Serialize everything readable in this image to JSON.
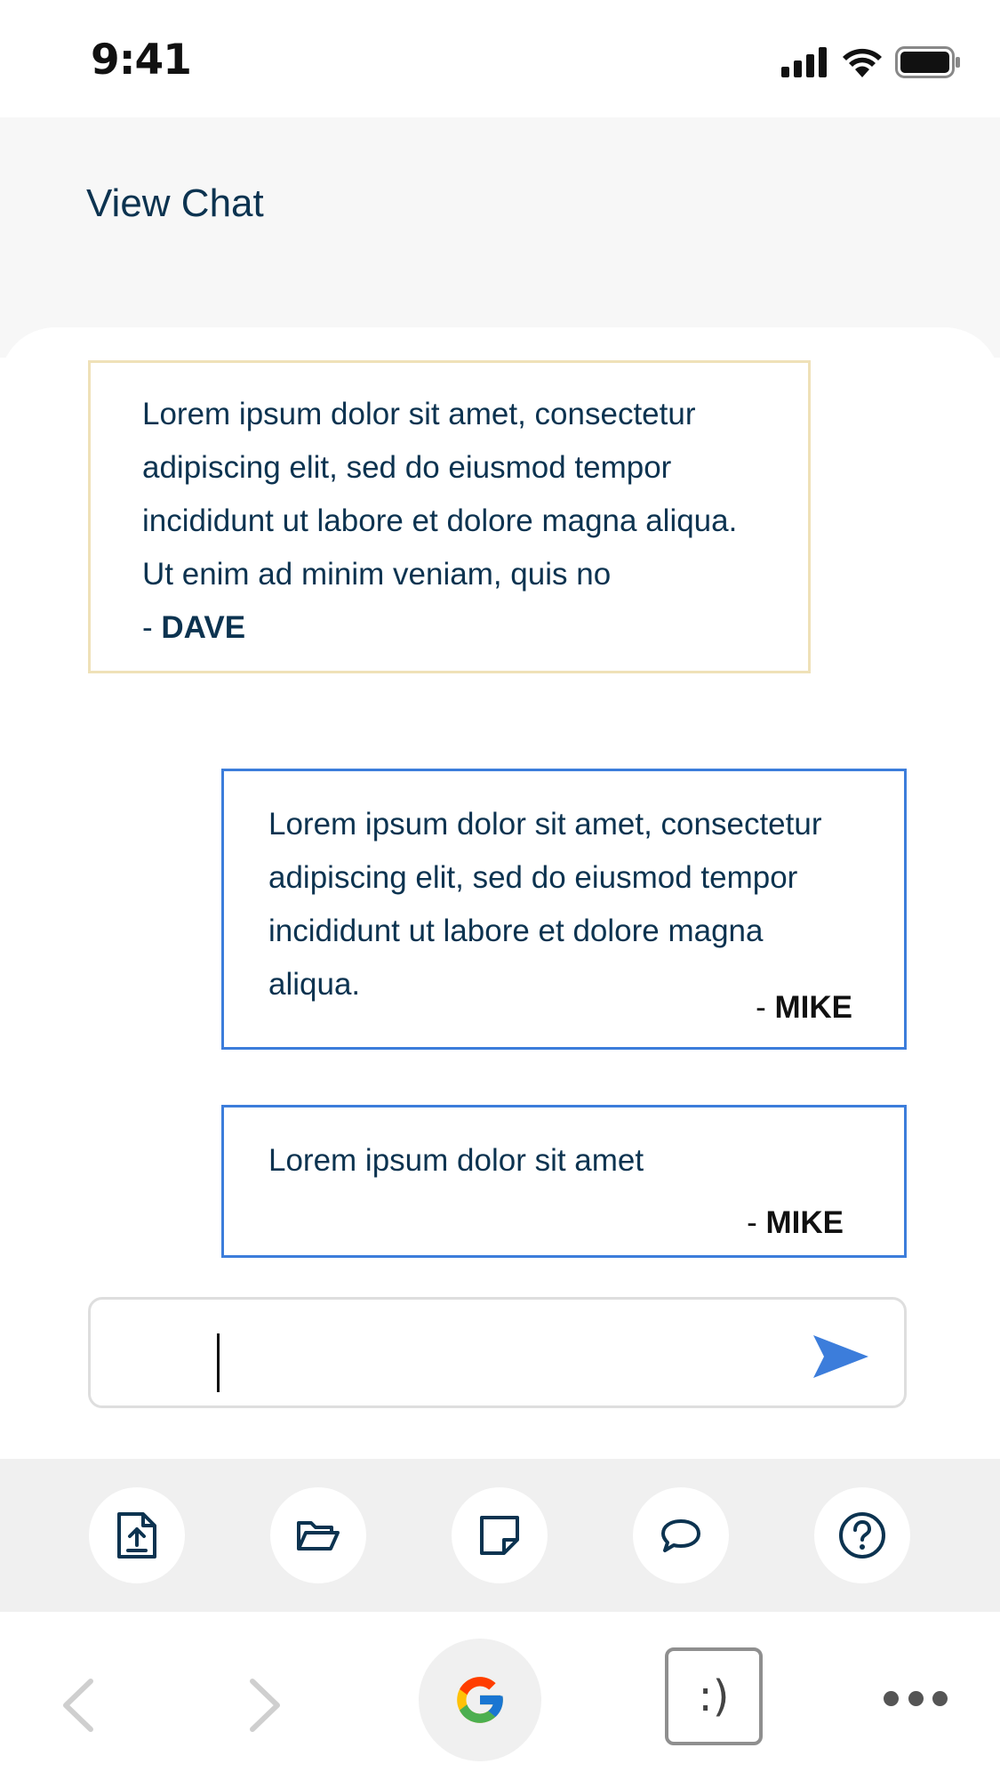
{
  "status_bar": {
    "time": "9:41",
    "icons": [
      "cellular-signal-icon",
      "wifi-icon",
      "battery-icon"
    ]
  },
  "header": {
    "title": "View Chat"
  },
  "messages": [
    {
      "text": "Lorem ipsum dolor sit amet, consectetur adipiscing elit, sed do eiusmod tempor incididunt ut labore et dolore magna aliqua. Ut enim ad minim veniam, quis no",
      "author_prefix": "- ",
      "author": "DAVE",
      "side": "left",
      "border_color": "#efe1b8"
    },
    {
      "text": "Lorem ipsum dolor sit amet, consectetur adipiscing elit, sed do eiusmod tempor incididunt ut labore et dolore magna aliqua.",
      "author_prefix": "- ",
      "author": "MIKE",
      "side": "right",
      "border_color": "#3c7ddb"
    },
    {
      "text": "Lorem ipsum dolor sit amet",
      "author_prefix": "- ",
      "author": "MIKE",
      "side": "right",
      "border_color": "#3c7ddb"
    }
  ],
  "input": {
    "value": "",
    "send_icon": "send-icon",
    "send_color": "#3c7ddb"
  },
  "toolbar": {
    "buttons": [
      "upload-file-icon",
      "folder-open-icon",
      "note-icon",
      "chat-bubble-icon",
      "help-icon"
    ]
  },
  "browser_bar": {
    "buttons": [
      "back-arrow-icon",
      "forward-arrow-icon",
      "google-icon",
      "tabs-icon",
      "more-icon"
    ],
    "tabs_label": ":)"
  },
  "colors": {
    "text": "#0c3350",
    "accent": "#3c7ddb",
    "dave_border": "#efe1b8",
    "header_bg": "#f7f7f7",
    "toolbar_bg": "#f0f0f0"
  }
}
